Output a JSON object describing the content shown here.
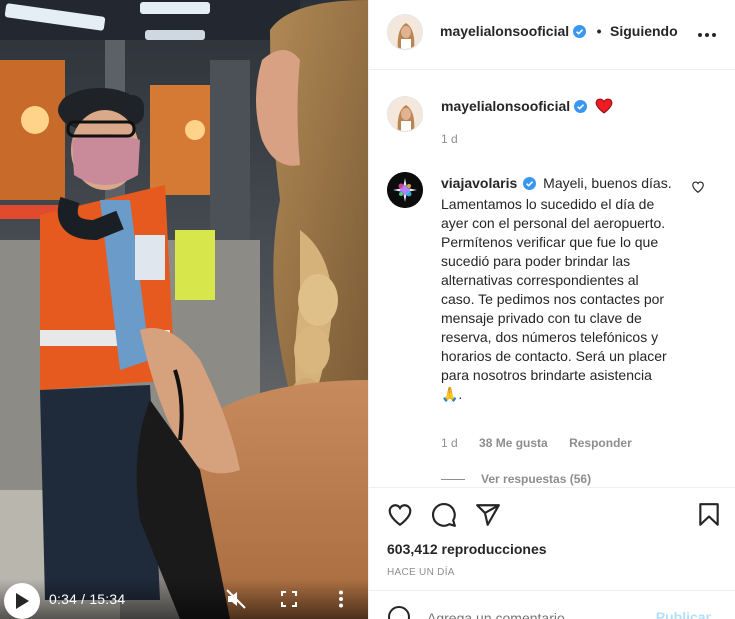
{
  "video": {
    "time_display": "0:34 / 15:34",
    "progress": 0.037
  },
  "header": {
    "username": "mayelialonsooficial",
    "separator": "•",
    "follow_status": "Siguiendo"
  },
  "caption": {
    "username": "mayelialonsooficial",
    "age": "1 d"
  },
  "comment": {
    "username": "viajavolaris",
    "text": "Mayeli, buenos días. Lamentamos lo sucedido el día de ayer con el personal del aeropuerto. Permítenos verificar que fue lo que sucedió para poder brindar las alternativas correspondientes al caso. Te pedimos nos contactes por mensaje privado con tu clave de reserva, dos números telefónicos y horarios de contacto. Será un placer para nosotros brindarte asistencia 🙏.",
    "age": "1 d",
    "likes": "38 Me gusta",
    "reply_label": "Responder",
    "view_replies": "Ver respuestas (56)"
  },
  "stats": {
    "views": "603,412 reproducciones",
    "posted": "HACE UN DÍA"
  },
  "add_comment": {
    "placeholder": "Agrega un comentario...",
    "post_label": "Publicar"
  },
  "colors": {
    "verified": "#3897f0",
    "heart": "#ed4956",
    "muted_text": "#8e8e8e"
  }
}
